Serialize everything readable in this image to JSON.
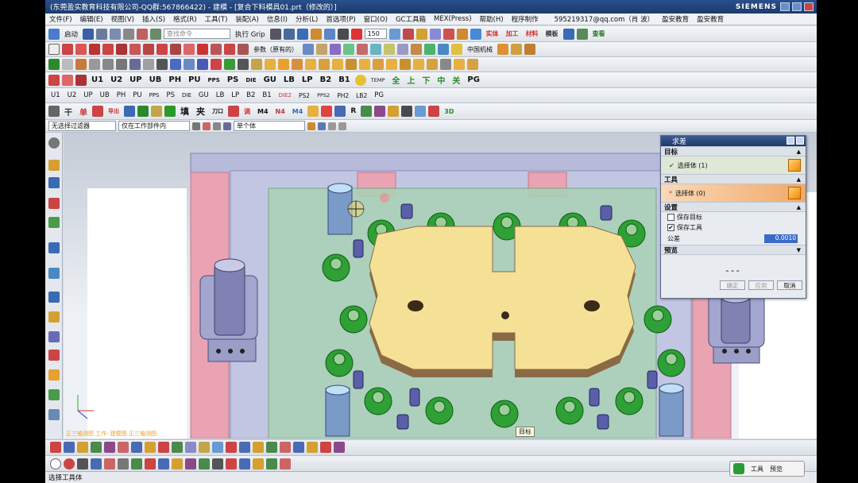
{
  "window": {
    "title": "(东莞盈实教育科技有限公司-QQ群:567866422) - 建模 - [复合下料模具01.prt（修改的）]",
    "brand": "SIEMENS"
  },
  "menu": {
    "items": [
      "文件(F)",
      "编辑(E)",
      "视图(V)",
      "插入(S)",
      "格式(R)",
      "工具(T)",
      "装配(A)",
      "信息(I)",
      "分析(L)",
      "首选项(P)",
      "窗口(O)",
      "GC工具箱",
      "MEX(Press)",
      "帮助(H)",
      "程序制作"
    ],
    "email": "595219317@qq.com（肖 波）",
    "extra1": "盈安教育",
    "extra2": "盈安教育"
  },
  "toolbar1": {
    "start_label": "启动",
    "command_search_placeholder": "查找命令",
    "exec_label": "执行 Grip",
    "zoom_value": "150",
    "params_label": "参数（原有的）",
    "color_label": "中国机械",
    "extra_labels": [
      "实体",
      "加工",
      "材料",
      "模板",
      "查看"
    ]
  },
  "toolbar4": {
    "labels": [
      "U1",
      "U2",
      "UP",
      "UB",
      "PH",
      "PU",
      "PPS",
      "PS",
      "DIE",
      "GU",
      "LB",
      "LP",
      "B2",
      "B1",
      "TEMP",
      "全",
      "上",
      "下",
      "中",
      "关",
      "PG"
    ]
  },
  "toolbar5": {
    "labels": [
      "U1",
      "U2",
      "UP",
      "UB",
      "PH",
      "PU",
      "PPS",
      "PS",
      "DIE",
      "GU",
      "LB",
      "LP",
      "B2",
      "B1",
      "DIE2",
      "PS2",
      "PPS2",
      "PH2",
      "LB2",
      "PG"
    ]
  },
  "toolbar6": {
    "labels": [
      "干",
      "单",
      "导出",
      "填",
      "夹",
      "刀口",
      "调",
      "M4",
      "N4",
      "M4",
      "R",
      "3D"
    ]
  },
  "filterbar": {
    "filter_value": "无选择过滤器",
    "scope_value": "仅在工作部件内",
    "type_value": "单个体"
  },
  "dialog": {
    "title": "求差",
    "target_section": "目标",
    "target_select": "选择体 (1)",
    "tool_section": "工具",
    "tool_select": "选择体 (0)",
    "settings_section": "设置",
    "keep_target": "保存目标",
    "keep_tool": "保存工具",
    "keep_target_checked": false,
    "keep_tool_checked": true,
    "tolerance_label": "公差",
    "tolerance_value": "0.0010",
    "preview_section": "预览",
    "ok_label": "确定",
    "apply_label": "应用",
    "cancel_label": "取消"
  },
  "viewport": {
    "tooltip": "目标",
    "triad_label": "正三轴测图 工作: 建模图 正三轴测图"
  },
  "statusbar": {
    "text": "选择工具体"
  },
  "badge": {
    "tool_label": "工具",
    "preview_label": "预览"
  },
  "colors": {
    "base_plate": "#b7bad9",
    "pink_block": "#e9a3b3",
    "green_plate": "#a9d2b6",
    "blank_part": "#f5e195",
    "guide_pin": "#2ea035",
    "post": "#9b9ec7"
  }
}
